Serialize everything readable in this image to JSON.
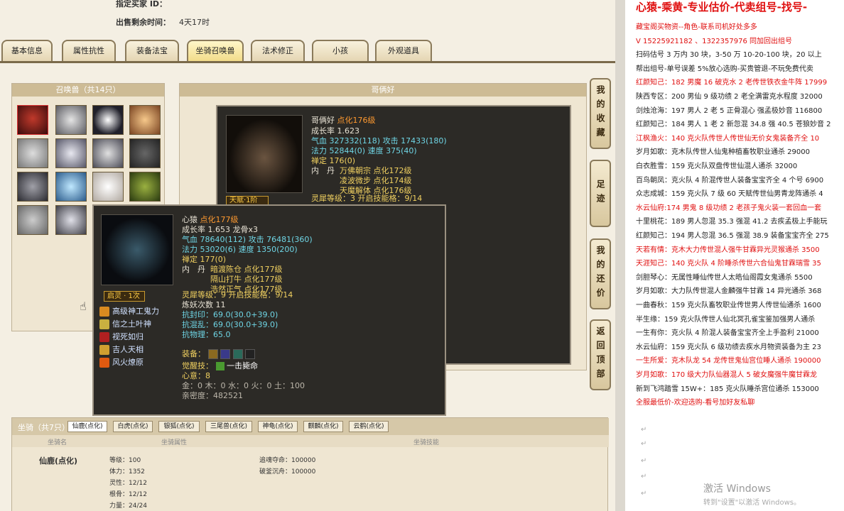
{
  "top": {
    "buyer_id_label": "指定买家 ID：",
    "remain_label": "出售剩余时间：",
    "remain_value": "4天17时"
  },
  "tabs": [
    "基本信息",
    "属性抗性",
    "装备法宝",
    "坐骑召唤兽",
    "法术修正",
    "小孩",
    "外观道具"
  ],
  "summon_panel": {
    "title": "召唤兽（共14只）",
    "selected_title": "哥俩好"
  },
  "tooltip_back": {
    "name": "哥俩好",
    "level": "点化176级",
    "growth": "成长率 1.623",
    "hp_label": "气血",
    "hp_value": "327332(118)",
    "atk_label": "攻击",
    "atk_value": "17433(180)",
    "mp_label": "法力",
    "mp_value": "52844(0)",
    "spd_label": "速度",
    "spd_value": "375(40)",
    "zen_label": "禅定",
    "zen_value": "176(0)",
    "neidan_label": "内　丹",
    "neidan": [
      "万佛朝宗 点化172级",
      "凌波微步 点化174级",
      "天魔解体 点化176级"
    ],
    "tianfu": "天赋·1阶",
    "lingxi": "灵犀等级：3 开启技能格：9/14"
  },
  "tooltip_front": {
    "name": "心猿",
    "level": "点化177级",
    "growth": "成长率 1.653 龙骨x3",
    "hp_label": "气血",
    "hp_value": "78640(112)",
    "atk_label": "攻击",
    "atk_value": "76481(360)",
    "mp_label": "法力",
    "mp_value": "53020(6)",
    "spd_label": "速度",
    "spd_value": "1350(200)",
    "zen_label": "禅定",
    "zen_value": "177(0)",
    "neidan_label": "内　丹",
    "neidan": [
      "暗渡陈仓 点化177级",
      "隔山打牛 点化177级",
      "浩然正气 点化177级"
    ],
    "qiling": "启灵 · 1次",
    "lingxi": "灵犀等级：9 开启技能格：9/14",
    "lianyao": "炼妖次数 11",
    "resist": [
      "抗封印：69.0(30.0+39.0)",
      "抗混乱：69.0(30.0+39.0)",
      "抗物理：65.0"
    ],
    "skills": [
      "高级神工鬼力",
      "信之土叶神",
      "视死如归",
      "吉人天相",
      "风火燎原"
    ],
    "equip_label": "装备：",
    "juexing_label": "觉醒技：",
    "juexing_value": "一击毙命",
    "xinyi": "心意：8",
    "wuxing": "金：0 木：0 水：0 火：0 土：100",
    "qinmi": "亲密度：482521"
  },
  "side_buttons": [
    "我的收藏",
    "足迹",
    "我的还价",
    "返回顶部"
  ],
  "mount_panel": {
    "header": "坐骑（共7只）",
    "tabs": [
      "仙鹿(点化)",
      "白虎(点化)",
      "银狐(点化)",
      "三尾兽(点化)",
      "神龟(点化)",
      "麒麟(点化)",
      "云鹤(点化)"
    ],
    "col_name": "坐骑名",
    "col_attr": "坐骑属性",
    "col_skill": "坐骑技能",
    "name": "仙鹿(点化)",
    "attrs": [
      "等级：100",
      "体力：1352",
      "灵性：12/12",
      "根骨：12/12",
      "力量：24/24"
    ],
    "skills": [
      "追魂夺命：100000",
      "破釜沉舟：100000"
    ]
  },
  "right_doc": {
    "title": "心猿-乘黄-专业估价-代卖组号-找号-",
    "lines": [
      {
        "t": "藏宝阁买物资--角色-联系司机好处多多",
        "c": "red"
      },
      {
        "t": "V 15225921182 、1322357976 同加回出组号",
        "c": "red"
      },
      {
        "t": "扫码估号 3 万内 30 块，3-50 万 10-20-100 块，20 以上",
        "c": "blk"
      },
      {
        "t": "帮出组号-单号误差 5%放心选购-买贵管退-不玩免费代卖",
        "c": "blk"
      },
      {
        "t": "红颜知己：182 男魔 16 破克水 2 老传世铁衣金牛阵 17999",
        "c": "red"
      },
      {
        "t": "陕西专区：200 男仙 9 级功绩 2 老全满雷克水程度 32000",
        "c": "blk"
      },
      {
        "t": "剑烛沧海：197 男人 2 老 5 正骨混心 强孟极妙音 116800",
        "c": "blk"
      },
      {
        "t": "红颜知己：184 男人 1 老 2 新忽混 34.8 强 40.5 苍狼妙音 2",
        "c": "blk"
      },
      {
        "t": "江枫渔火：140 克火队传世人传世仙无价女鬼装备齐全 10",
        "c": "red"
      },
      {
        "t": "岁月如歌：克木队传世人仙鬼种植畜牧职业通杀 29000",
        "c": "blk"
      },
      {
        "t": "白衣胜雪：159 克火队双盘传世仙混人通杀 32000",
        "c": "blk"
      },
      {
        "t": "百鸟朝凤：克火队 4 阶混传世人装备宝宝齐全 4 个号 6900",
        "c": "blk"
      },
      {
        "t": "众志成城：159 克火队 7 级 60 天赋传世仙男青龙阵通杀 4",
        "c": "blk"
      },
      {
        "t": "水云仙府:174 男鬼 8 级功绩 2 老孩子鬼火装一套回血一套",
        "c": "red"
      },
      {
        "t": "十里桃花：189 男人忽混 35.3 强混 41.2 去疾孟极上手能玩",
        "c": "blk"
      },
      {
        "t": "红颜知己：194 男人忽混 36.5 强混 38.9 装备宝宝齐全 275",
        "c": "blk"
      },
      {
        "t": "天若有情：克木大力传世混人强牛甘霖异光灵猴通杀 3500",
        "c": "red"
      },
      {
        "t": "天涯知己：140 克火队 4 阶睡杀传世六合仙鬼甘霖瑞雪 35",
        "c": "red"
      },
      {
        "t": "剑胆琴心：无属性睡仙传世人太皓仙阁霞女鬼通杀 5500",
        "c": "blk"
      },
      {
        "t": "岁月如歌：大力队传世混人金麟强牛甘霖 14 异光通杀 368",
        "c": "blk"
      },
      {
        "t": "一曲春秋：159 克火队畜牧职业传世男人传世仙通杀 1600",
        "c": "blk"
      },
      {
        "t": "半生缘：159 克火队传世人仙北冥孔雀宝鉴加强男人通杀",
        "c": "blk"
      },
      {
        "t": "一生有你：克火队 4 阶混人装备宝宝齐全上手盈利 21000",
        "c": "blk"
      },
      {
        "t": "水云仙府：159 克火队 6 级功绩去疾水月物资装备为主 23",
        "c": "blk"
      },
      {
        "t": "一生所爱：克木队龙 54 龙传世鬼仙宫位睡人通杀 190000",
        "c": "red"
      },
      {
        "t": "岁月如歌：170 级大力队仙器混人 5 破女魔强牛魔甘霖龙",
        "c": "red"
      },
      {
        "t": "新到飞鸿踏雪 15W+：185 克火队睡杀宫位通杀 153000",
        "c": "blk"
      },
      {
        "t": "全服最低价-欢迎选购-看号加好友私聊",
        "c": "red"
      }
    ],
    "watermark_1": "激活 Windows",
    "watermark_2": "转到\"设置\"以激活 Windows。"
  }
}
